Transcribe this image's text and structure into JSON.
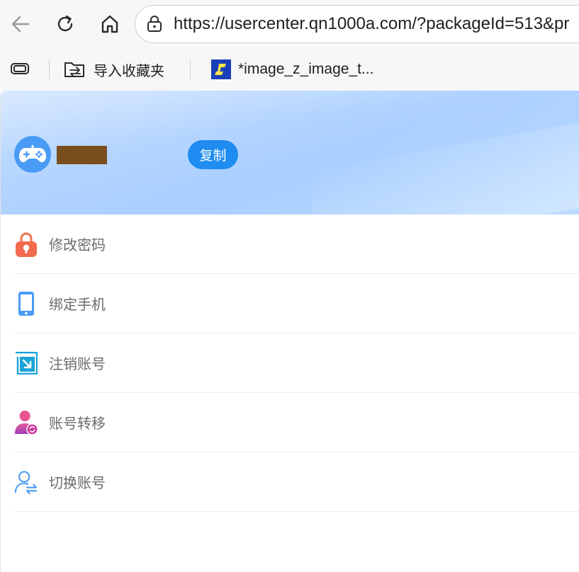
{
  "browser": {
    "url": "https://usercenter.qn1000a.com/?packageId=513&pr",
    "bookmarks": [
      {
        "label": "导入收藏夹",
        "icon": "folder-import-icon"
      },
      {
        "label": "*image_z_image_t..."
      }
    ]
  },
  "profile": {
    "copy_label": "复制",
    "avatar_icon": "gamepad-icon",
    "accent_color": "#1e8cf0"
  },
  "menu": {
    "items": [
      {
        "label": "修改密码",
        "icon": "lock-icon"
      },
      {
        "label": "绑定手机",
        "icon": "phone-icon"
      },
      {
        "label": "注销账号",
        "icon": "logout-arrow-icon"
      },
      {
        "label": "账号转移",
        "icon": "user-transfer-icon"
      },
      {
        "label": "切换账号",
        "icon": "user-switch-icon"
      }
    ]
  }
}
